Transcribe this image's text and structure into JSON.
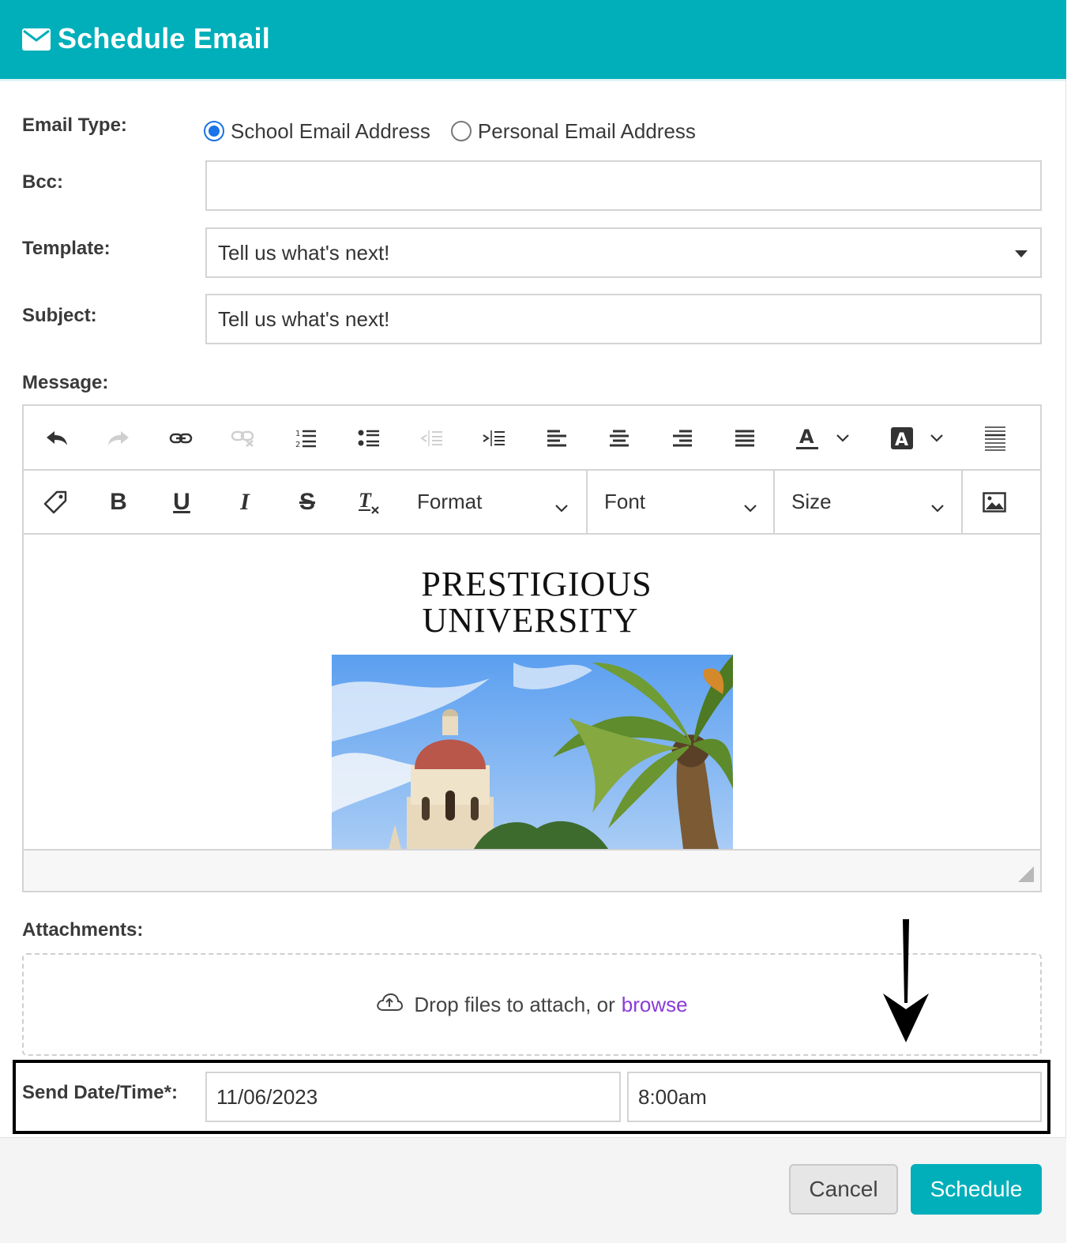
{
  "header": {
    "title": "Schedule Email",
    "icon": "envelope-icon",
    "color": "#00afba"
  },
  "form": {
    "email_type": {
      "label": "Email Type:",
      "options": [
        {
          "label": "School Email Address",
          "checked": true
        },
        {
          "label": "Personal Email Address",
          "checked": false
        }
      ]
    },
    "bcc": {
      "label": "Bcc:",
      "value": ""
    },
    "template": {
      "label": "Template:",
      "value": "Tell us what's next!"
    },
    "subject": {
      "label": "Subject:",
      "value": "Tell us what's next!"
    },
    "message": {
      "label": "Message:"
    }
  },
  "editor": {
    "toolbar1": [
      "undo-icon",
      "redo-icon",
      "link-icon",
      "unlink-icon",
      "numbered-list-icon",
      "bulleted-list-icon",
      "outdent-icon",
      "indent-icon",
      "align-left-icon",
      "align-center-icon",
      "align-right-icon",
      "align-justify-icon",
      "text-color-icon",
      "background-color-icon",
      "source-icon"
    ],
    "toolbar2": {
      "buttons": [
        "tag-icon",
        "bold-icon",
        "underline-icon",
        "italic-icon",
        "strikethrough-icon",
        "clear-format-icon",
        "image-icon"
      ],
      "format_label": "Format",
      "font_label": "Font",
      "size_label": "Size"
    },
    "content": {
      "logo_line1": "PRESTIGIOUS",
      "logo_line2": "UNIVERSITY"
    }
  },
  "attachments": {
    "label": "Attachments:",
    "drop_text": "Drop files to attach, or",
    "browse_label": "browse",
    "browse_color": "#8a3bd8"
  },
  "send": {
    "label": "Send Date/Time*:",
    "date": "11/06/2023",
    "time": "8:00am"
  },
  "footer": {
    "cancel_label": "Cancel",
    "schedule_label": "Schedule"
  }
}
